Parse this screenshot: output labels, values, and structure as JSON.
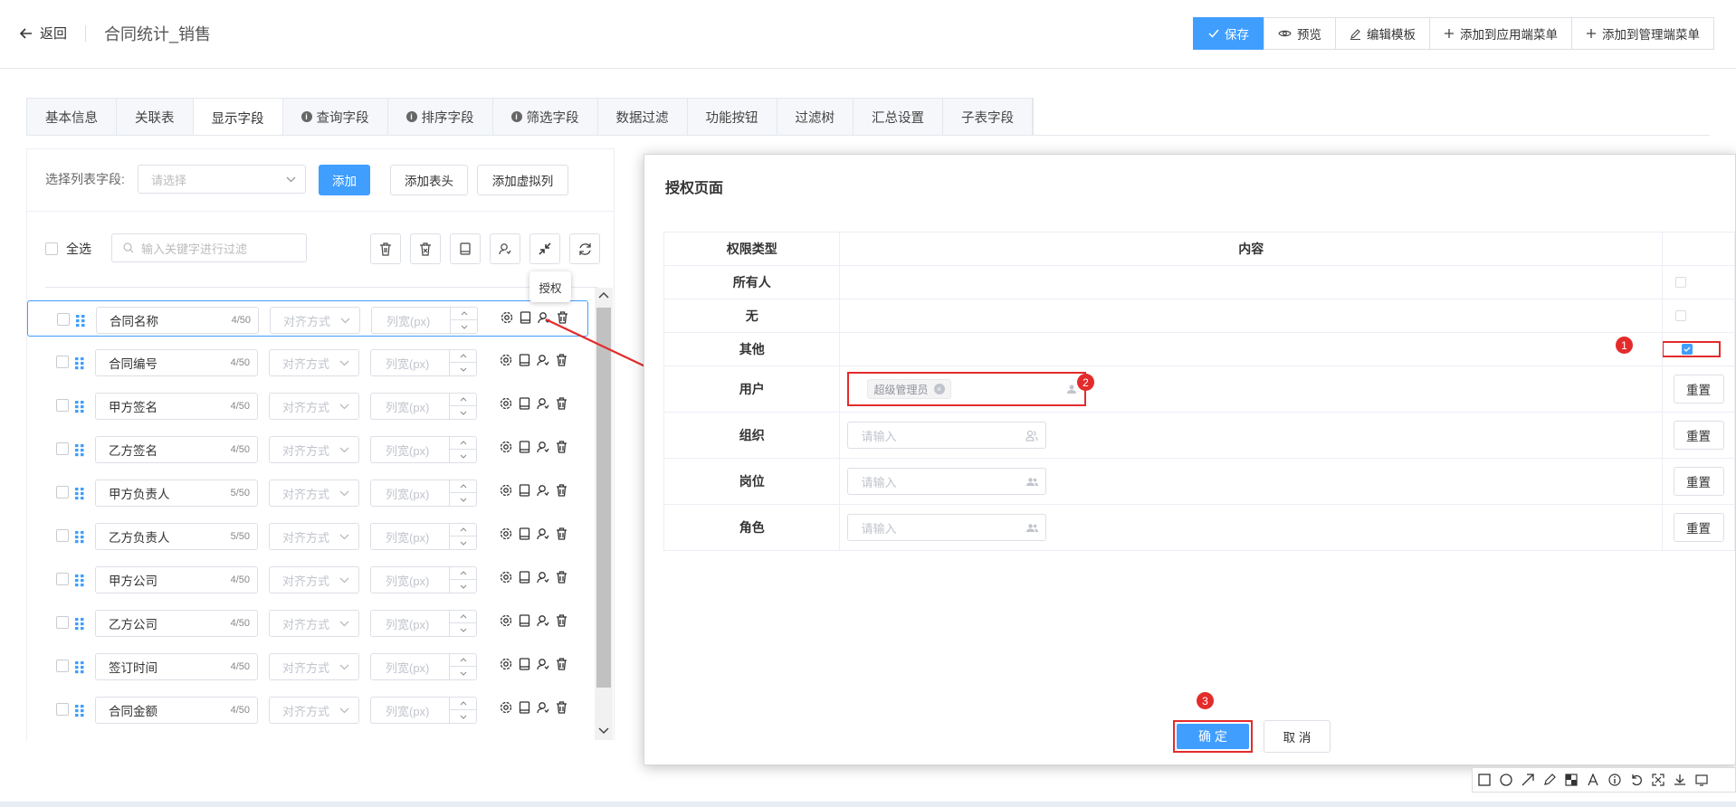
{
  "header": {
    "back_label": "返回",
    "title": "合同统计_销售",
    "buttons": {
      "save": "保存",
      "preview": "预览",
      "edit_template": "编辑模板",
      "add_app_menu": "添加到应用端菜单",
      "add_admin_menu": "添加到管理端菜单"
    }
  },
  "tabs": [
    "基本信息",
    "关联表",
    "显示字段",
    "查询字段",
    "排序字段",
    "筛选字段",
    "数据过滤",
    "功能按钮",
    "过滤树",
    "汇总设置",
    "子表字段"
  ],
  "active_tab": "显示字段",
  "left_panel": {
    "select_label": "选择列表字段:",
    "select_placeholder": "请选择",
    "add_btn": "添加",
    "add_header_btn": "添加表头",
    "add_virtual_btn": "添加虚拟列",
    "select_all": "全选",
    "filter_placeholder": "输入关键字进行过滤",
    "align_placeholder": "对齐方式",
    "width_placeholder": "列宽(px)",
    "fields": [
      {
        "name": "合同名称",
        "count": "4/50"
      },
      {
        "name": "合同编号",
        "count": "4/50"
      },
      {
        "name": "甲方签名",
        "count": "4/50"
      },
      {
        "name": "乙方签名",
        "count": "4/50"
      },
      {
        "name": "甲方负责人",
        "count": "5/50"
      },
      {
        "name": "乙方负责人",
        "count": "5/50"
      },
      {
        "name": "甲方公司",
        "count": "4/50"
      },
      {
        "name": "乙方公司",
        "count": "4/50"
      },
      {
        "name": "签订时间",
        "count": "4/50"
      },
      {
        "name": "合同金额",
        "count": "4/50"
      }
    ]
  },
  "tooltip": "授权",
  "dialog": {
    "title": "授权页面",
    "col_type": "权限类型",
    "col_content": "内容",
    "rows": {
      "all": "所有人",
      "none": "无",
      "other": "其他",
      "user": "用户",
      "org": "组织",
      "post": "岗位",
      "role": "角色"
    },
    "user_tag": "超级管理员",
    "input_placeholder": "请输入",
    "reset": "重置",
    "confirm": "确 定",
    "cancel": "取 消",
    "badges": [
      "1",
      "2",
      "3"
    ]
  },
  "colors": {
    "primary": "#409eff",
    "annotation": "#e42b2b"
  }
}
